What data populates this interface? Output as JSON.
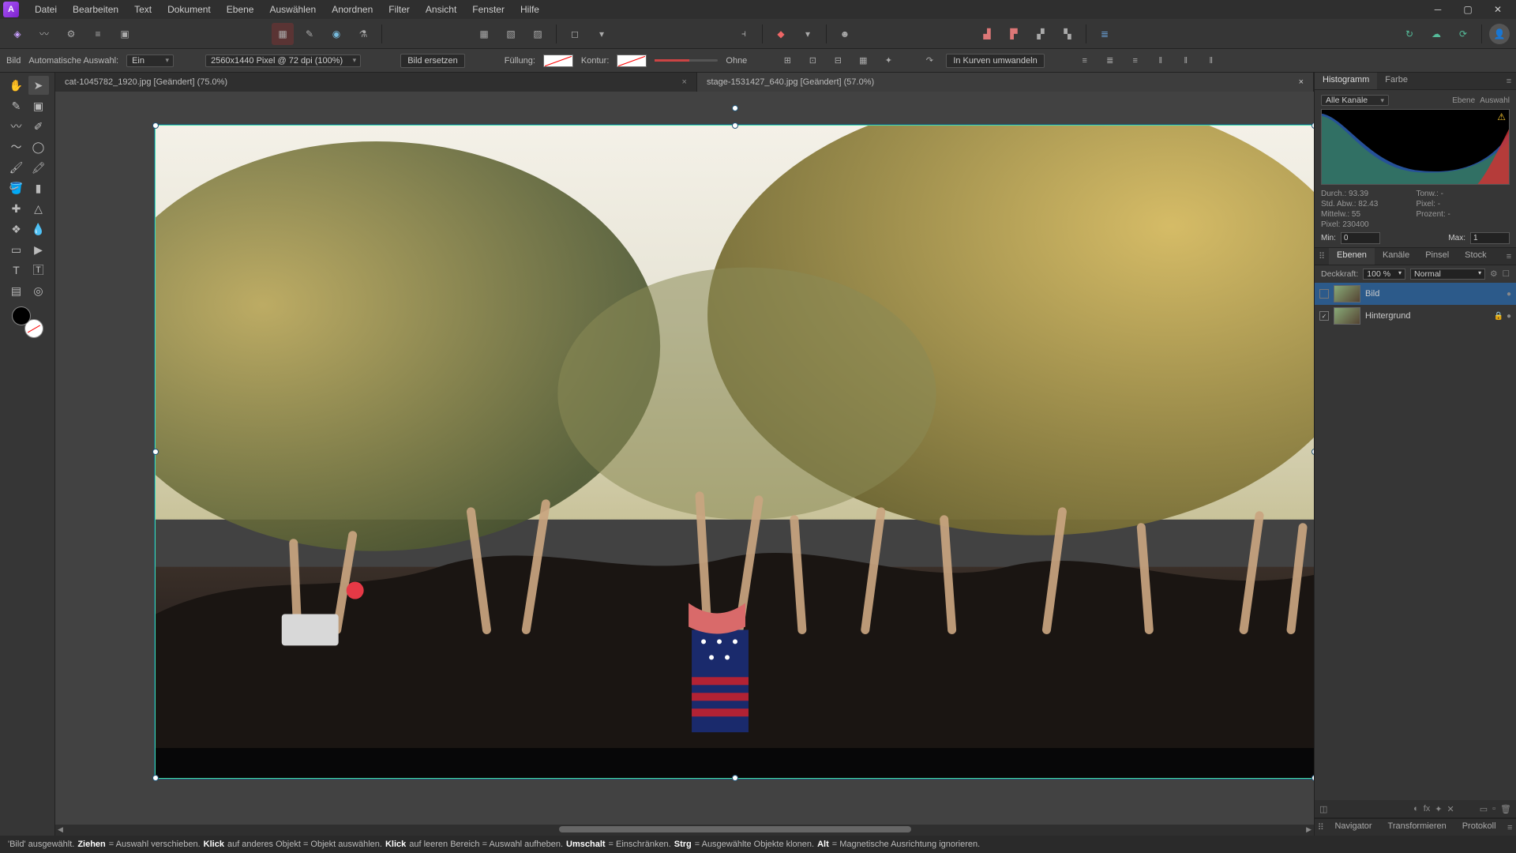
{
  "menubar": [
    "Datei",
    "Bearbeiten",
    "Text",
    "Dokument",
    "Ebene",
    "Auswählen",
    "Anordnen",
    "Filter",
    "Ansicht",
    "Fenster",
    "Hilfe"
  ],
  "context": {
    "mode_label": "Bild",
    "auto_select_label": "Automatische Auswahl:",
    "auto_select_value": "Ein",
    "dimensions": "2560x1440 Pixel @ 72 dpi (100%)",
    "replace_label": "Bild ersetzen",
    "fill_label": "Füllung:",
    "stroke_label": "Kontur:",
    "stroke_none": "Ohne",
    "curves_label": "In Kurven umwandeln"
  },
  "tabs": {
    "tab1": "cat-1045782_1920.jpg [Geändert] (75.0%)",
    "tab2": "stage-1531427_640.jpg [Geändert] (57.0%)"
  },
  "right": {
    "hist_tab": "Histogramm",
    "color_tab": "Farbe",
    "channels_label": "Alle Kanäle",
    "level_btn": "Ebene",
    "select_btn": "Auswahl",
    "stats": {
      "mean_l": "Durch.:",
      "mean_v": "93.39",
      "std_l": "Std. Abw.:",
      "std_v": "82.43",
      "med_l": "Mittelw.:",
      "med_v": "55",
      "px_l": "Pixel:",
      "px_v": "230400",
      "tone_l": "Tonw.:",
      "tone_v": "-",
      "pxr_l": "Pixel:",
      "pxr_v": "-",
      "pct_l": "Prozent:",
      "pct_v": "-"
    },
    "min_l": "Min:",
    "min_v": "0",
    "max_l": "Max:",
    "max_v": "1",
    "layers_tab": "Ebenen",
    "chan_tab": "Kanäle",
    "brush_tab": "Pinsel",
    "stock_tab": "Stock",
    "opacity_label": "Deckkraft:",
    "opacity_value": "100 %",
    "blend_value": "Normal",
    "layer1": "Bild",
    "layer2": "Hintergrund",
    "nav_tab": "Navigator",
    "trans_tab": "Transformieren",
    "proto_tab": "Protokoll"
  },
  "status": {
    "s1a": "'Bild' ausgewählt. ",
    "s1b": "Ziehen",
    "s1c": " = Auswahl verschieben. ",
    "s2b": "Klick",
    "s2c": " auf anderes Objekt = Objekt auswählen. ",
    "s3b": "Klick",
    "s3c": " auf leeren Bereich = Auswahl aufheben. ",
    "s4b": "Umschalt",
    "s4c": " = Einschränken. ",
    "s5b": "Strg",
    "s5c": " = Ausgewählte Objekte klonen. ",
    "s6b": "Alt",
    "s6c": " = Magnetische Ausrichtung ignorieren."
  }
}
